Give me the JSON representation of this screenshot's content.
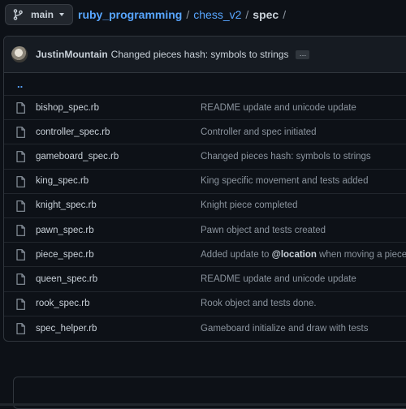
{
  "branch": {
    "label": "main",
    "icon": "git-branch-icon"
  },
  "breadcrumb": {
    "repo": "ruby_programming",
    "folder": "chess_v2",
    "current": "spec",
    "separator": "/"
  },
  "latest_commit": {
    "author": "JustinMountain",
    "message": "Changed pieces hash: symbols to strings",
    "ellipsis": "…"
  },
  "parent_dir": "..",
  "files": [
    {
      "name": "bishop_spec.rb",
      "commit": "README update and unicode update"
    },
    {
      "name": "controller_spec.rb",
      "commit": "Controller and spec initiated"
    },
    {
      "name": "gameboard_spec.rb",
      "commit": "Changed pieces hash: symbols to strings"
    },
    {
      "name": "king_spec.rb",
      "commit": "King specific movement and tests added"
    },
    {
      "name": "knight_spec.rb",
      "commit": "Knight piece completed"
    },
    {
      "name": "pawn_spec.rb",
      "commit": "Pawn object and tests created"
    },
    {
      "name": "piece_spec.rb",
      "commit_pre": "Added update to ",
      "commit_mention": "@location",
      "commit_post": " when moving a piece"
    },
    {
      "name": "queen_spec.rb",
      "commit": "README update and unicode update"
    },
    {
      "name": "rook_spec.rb",
      "commit": "Rook object and tests done."
    },
    {
      "name": "spec_helper.rb",
      "commit": "Gameboard initialize and draw with tests"
    }
  ],
  "colors": {
    "background": "#0d1117",
    "link": "#58a6ff",
    "muted": "#8b949e",
    "border": "#30363d"
  }
}
